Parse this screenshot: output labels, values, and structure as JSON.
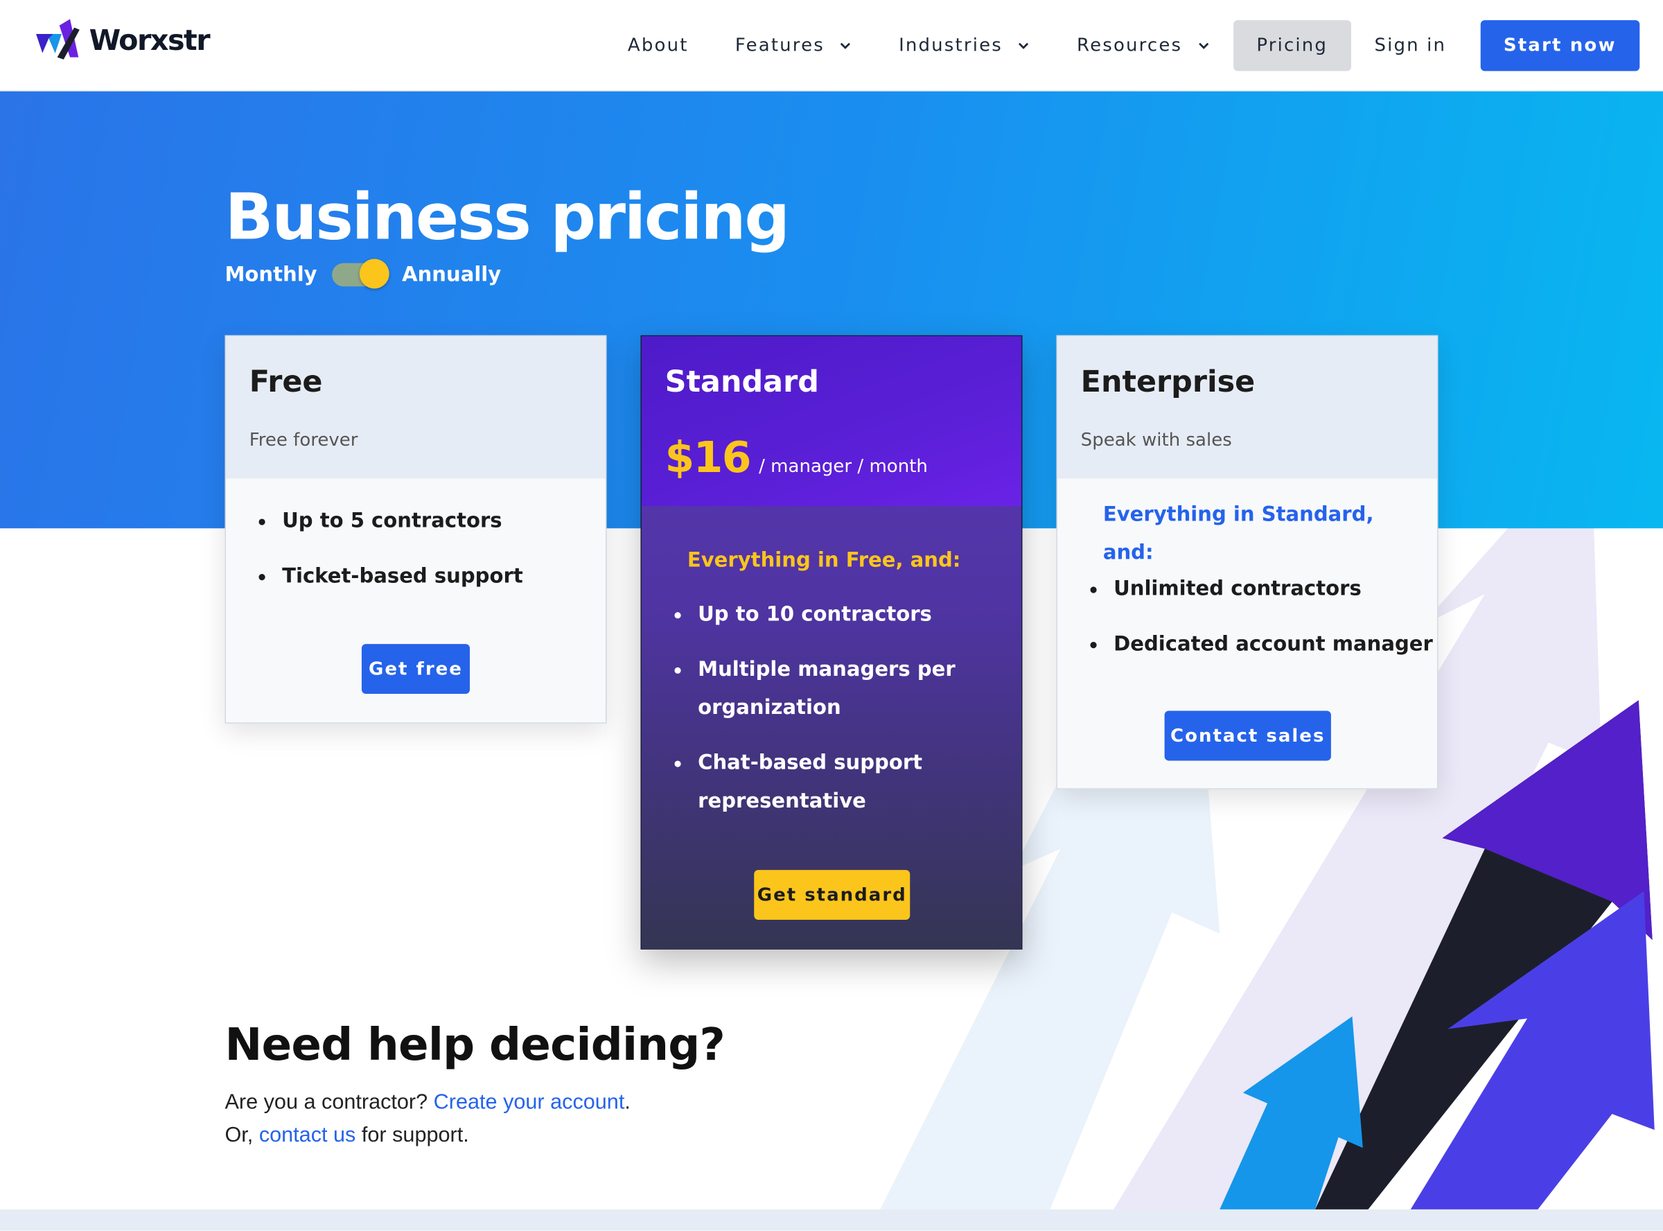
{
  "brand": {
    "name": "Worxstr"
  },
  "nav": {
    "about": "About",
    "features": "Features",
    "industries": "Industries",
    "resources": "Resources",
    "pricing": "Pricing",
    "sign_in": "Sign in",
    "start_now": "Start now"
  },
  "hero": {
    "title": "Business pricing",
    "billing_monthly": "Monthly",
    "billing_annually": "Annually",
    "billing_selected": "Annually"
  },
  "plans": {
    "free": {
      "name": "Free",
      "subtitle": "Free forever",
      "features": [
        "Up to 5 contractors",
        "Ticket-based support"
      ],
      "cta": "Get free"
    },
    "standard": {
      "name": "Standard",
      "price": "$16",
      "price_unit": "/ manager / month",
      "intro": "Everything in Free, and:",
      "features": [
        "Up to 10 contractors",
        "Multiple managers per organization",
        "Chat-based support representative"
      ],
      "cta": "Get standard"
    },
    "enterprise": {
      "name": "Enterprise",
      "subtitle": "Speak with sales",
      "intro": "Everything in Standard, and:",
      "features": [
        "Unlimited contractors",
        "Dedicated account manager"
      ],
      "cta": "Contact sales"
    }
  },
  "help": {
    "title": "Need help deciding?",
    "line1_prefix": "Are you a contractor?",
    "line1_link": "Create your account",
    "line1_suffix": ".",
    "line2_prefix": "Or,",
    "line2_link": "contact us",
    "line2_suffix": "for support."
  },
  "colors": {
    "accent": "#2563eb",
    "yellow": "#fbc51c",
    "standard_purple": "#5a1fd6",
    "hero_blue": "#1a8ef0"
  }
}
